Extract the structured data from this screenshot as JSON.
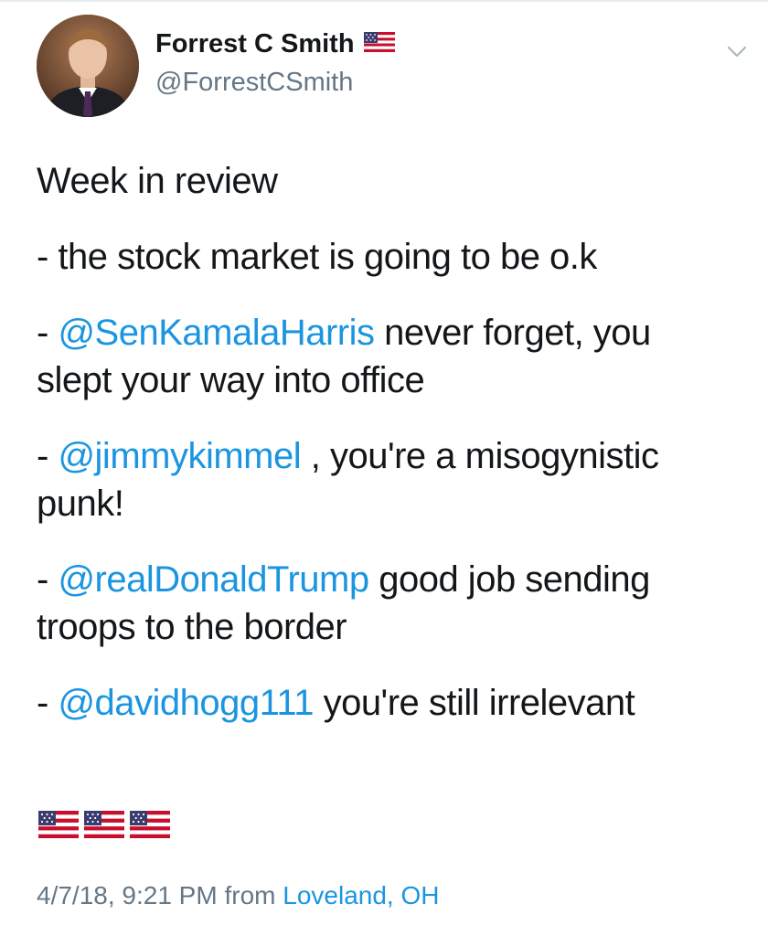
{
  "author": {
    "display_name": "Forrest C Smith",
    "handle": "@ForrestCSmith",
    "name_badge_icon": "us-flag-icon"
  },
  "menu": {
    "icon": "chevron-down-icon"
  },
  "tweet": {
    "title_line": "Week in review",
    "line1": "- the stock market is going to be o.k",
    "line2": {
      "prefix": "- ",
      "mention": "@SenKamalaHarris",
      "text_a": " never forget, you",
      "text_b": "slept your way into office"
    },
    "line3": {
      "prefix": "- ",
      "mention": "@jimmykimmel",
      "text_a": " , you're a misogynistic",
      "text_b": "punk!"
    },
    "line4": {
      "prefix": "-  ",
      "mention": "@realDonaldTrump",
      "text_a": " good job sending",
      "text_b": "troops to the border"
    },
    "line5": {
      "prefix": "- ",
      "mention": "@davidhogg111",
      "text_a": " you're still irrelevant"
    },
    "emoji_flags": [
      "us-flag-icon",
      "us-flag-icon",
      "us-flag-icon"
    ]
  },
  "meta": {
    "timestamp": "4/7/18, 9:21 PM",
    "from_label": "from",
    "location": "Loveland, OH"
  },
  "colors": {
    "link": "#1b95e0",
    "secondary_text": "#657786",
    "primary_text": "#14171a"
  }
}
